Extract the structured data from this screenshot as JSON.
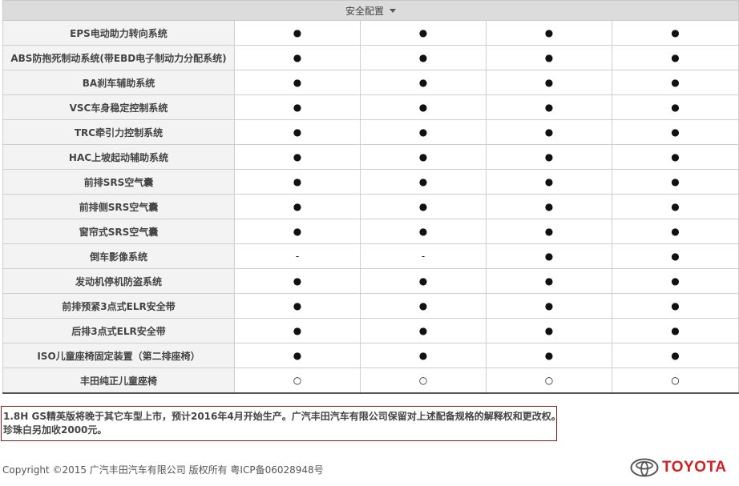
{
  "section": {
    "title": "安全配置"
  },
  "columns_count": 4,
  "rows": [
    {
      "label": "EPS电动助力转向系统",
      "values": [
        "●",
        "●",
        "●",
        "●"
      ]
    },
    {
      "label": "ABS防抱死制动系统(带EBD电子制动力分配系统)",
      "values": [
        "●",
        "●",
        "●",
        "●"
      ]
    },
    {
      "label": "BA刹车辅助系统",
      "values": [
        "●",
        "●",
        "●",
        "●"
      ]
    },
    {
      "label": "VSC车身稳定控制系统",
      "values": [
        "●",
        "●",
        "●",
        "●"
      ]
    },
    {
      "label": "TRC牵引力控制系统",
      "values": [
        "●",
        "●",
        "●",
        "●"
      ]
    },
    {
      "label": "HAC上坡起动辅助系统",
      "values": [
        "●",
        "●",
        "●",
        "●"
      ]
    },
    {
      "label": "前排SRS空气囊",
      "values": [
        "●",
        "●",
        "●",
        "●"
      ]
    },
    {
      "label": "前排侧SRS空气囊",
      "values": [
        "●",
        "●",
        "●",
        "●"
      ]
    },
    {
      "label": "窗帘式SRS空气囊",
      "values": [
        "●",
        "●",
        "●",
        "●"
      ]
    },
    {
      "label": "倒车影像系统",
      "values": [
        "-",
        "-",
        "●",
        "●"
      ]
    },
    {
      "label": "发动机停机防盗系统",
      "values": [
        "●",
        "●",
        "●",
        "●"
      ]
    },
    {
      "label": "前排预紧3点式ELR安全带",
      "values": [
        "●",
        "●",
        "●",
        "●"
      ]
    },
    {
      "label": "后排3点式ELR安全带",
      "values": [
        "●",
        "●",
        "●",
        "●"
      ]
    },
    {
      "label": "ISO儿童座椅固定装置（第二排座椅）",
      "values": [
        "●",
        "●",
        "●",
        "●"
      ]
    },
    {
      "label": "丰田纯正儿童座椅",
      "values": [
        "○",
        "○",
        "○",
        "○"
      ]
    }
  ],
  "notice": {
    "line1": "1.8H GS精英版将晚于其它车型上市，预计2016年4月开始生产。广汽丰田汽车有限公司保留对上述配备规格的解释权和更改权。",
    "line2": "珍珠白另加收2000元。"
  },
  "footer": {
    "copyright": "Copyright ©2015 广汽丰田汽车有限公司 版权所有 粤ICP备06028948号",
    "logo_text": "TOYOTA",
    "logo_icon": "toyota-emblem-icon",
    "brand_color": "#d21f26"
  }
}
